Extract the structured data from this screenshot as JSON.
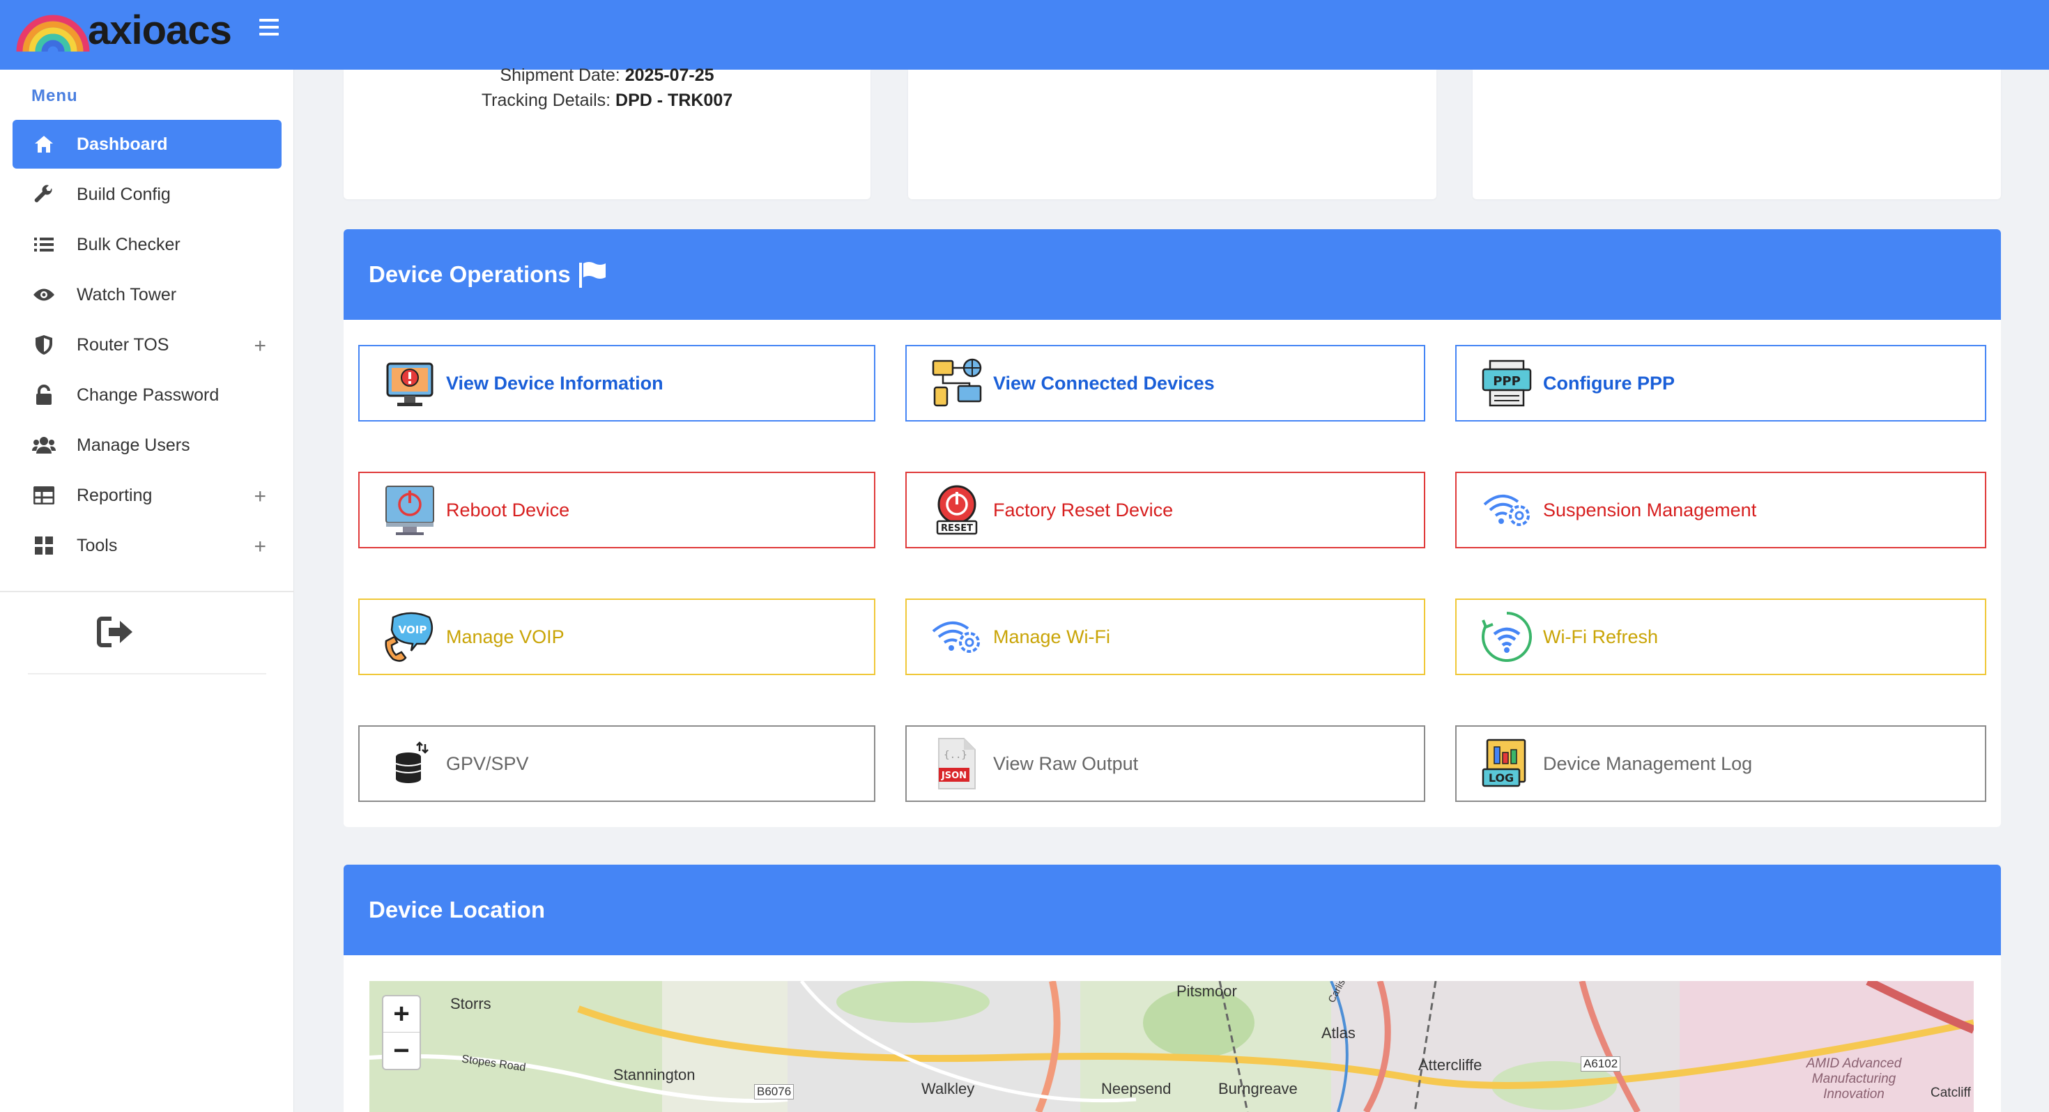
{
  "header": {
    "brand": "axioacs"
  },
  "sidebar": {
    "menu_label": "Menu",
    "items": [
      {
        "label": "Dashboard",
        "icon": "home-icon",
        "active": true
      },
      {
        "label": "Build Config",
        "icon": "wrench-icon"
      },
      {
        "label": "Bulk Checker",
        "icon": "list-icon"
      },
      {
        "label": "Watch Tower",
        "icon": "eye-icon"
      },
      {
        "label": "Router TOS",
        "icon": "shield-icon",
        "expandable": true
      },
      {
        "label": "Change Password",
        "icon": "lock-icon"
      },
      {
        "label": "Manage Users",
        "icon": "users-icon"
      },
      {
        "label": "Reporting",
        "icon": "table-icon",
        "expandable": true
      },
      {
        "label": "Tools",
        "icon": "grid-icon",
        "expandable": true
      }
    ],
    "expand_symbol": "+",
    "logout_icon": "logout-icon"
  },
  "shipment": {
    "date_label": "Shipment Date:",
    "date_value": "2025-07-25",
    "tracking_label": "Tracking Details:",
    "tracking_value": "DPD - TRK007"
  },
  "operations": {
    "title": "Device Operations",
    "buttons": [
      {
        "label": "View Device Information",
        "icon": "device-info-icon",
        "color": "#4585f5"
      },
      {
        "label": "View Connected Devices",
        "icon": "connected-devices-icon",
        "color": "#4585f5"
      },
      {
        "label": "Configure PPP",
        "icon": "ppp-icon",
        "color": "#4585f5"
      },
      {
        "label": "Reboot Device",
        "icon": "reboot-icon",
        "color": "#e03a3a"
      },
      {
        "label": "Factory Reset Device",
        "icon": "reset-icon",
        "color": "#e03a3a"
      },
      {
        "label": "Suspension Management",
        "icon": "wifi-gear-icon",
        "color": "#e03a3a"
      },
      {
        "label": "Manage VOIP",
        "icon": "voip-icon",
        "color": "#f0c838"
      },
      {
        "label": "Manage Wi-Fi",
        "icon": "wifi-settings-icon",
        "color": "#f0c838"
      },
      {
        "label": "Wi-Fi Refresh",
        "icon": "wifi-refresh-icon",
        "color": "#f0c838"
      },
      {
        "label": "GPV/SPV",
        "icon": "database-icon",
        "color": "#8b8b8b"
      },
      {
        "label": "View Raw Output",
        "icon": "json-file-icon",
        "color": "#8b8b8b"
      },
      {
        "label": "Device Management Log",
        "icon": "log-icon",
        "color": "#8b8b8b"
      }
    ]
  },
  "location": {
    "title": "Device Location",
    "zoom_in": "+",
    "zoom_out": "−",
    "map_labels": [
      "Storrs",
      "Pitsmoor",
      "Atlas",
      "Stannington",
      "Stopes Road",
      "B6076",
      "Walkley",
      "Neepsend",
      "Burngreave",
      "Attercliffe",
      "A6102",
      "AMID Advanced Manufacturing Innovation",
      "Catcliff",
      "Carlisle Street East"
    ]
  }
}
